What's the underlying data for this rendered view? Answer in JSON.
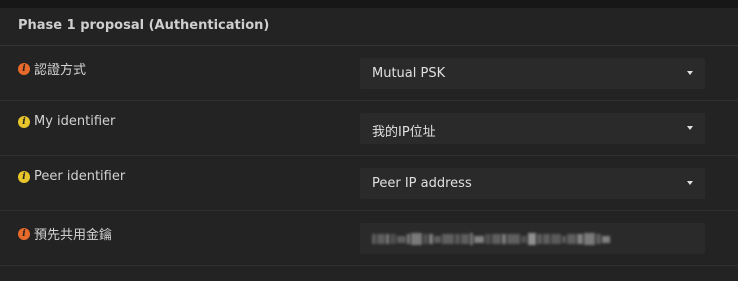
{
  "section": {
    "title": "Phase 1 proposal (Authentication)"
  },
  "rows": [
    {
      "label": "認證方式",
      "info_icon_color": "#e86a2b",
      "control_type": "select",
      "value": "Mutual PSK"
    },
    {
      "label": "My identifier",
      "info_icon_color": "#e8c62b",
      "control_type": "select",
      "value": "我的IP位址"
    },
    {
      "label": "Peer identifier",
      "info_icon_color": "#e8c62b",
      "control_type": "select",
      "value": "Peer IP address"
    },
    {
      "label": "預先共用金鑰",
      "info_icon_color": "#e86a2b",
      "control_type": "password",
      "value_obscured": true
    }
  ],
  "icons": {
    "info": "info-circle-icon",
    "dropdown": "caret-down-icon"
  },
  "colors": {
    "background": "#232323",
    "control_bg": "#2a2a2a",
    "info_orange": "#e86a2b",
    "info_yellow": "#e8c62b"
  }
}
